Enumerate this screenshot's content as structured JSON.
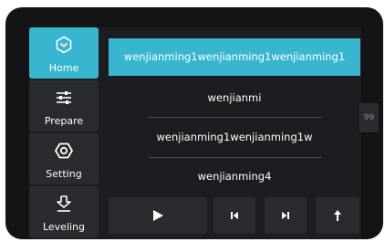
{
  "sidebar": {
    "items": [
      {
        "label": "Home",
        "icon": "home-hexagon-icon"
      },
      {
        "label": "Prepare",
        "icon": "sliders-icon"
      },
      {
        "label": "Setting",
        "icon": "settings-hex-icon"
      },
      {
        "label": "Leveling",
        "icon": "leveling-icon"
      }
    ]
  },
  "files": [
    "wenjianming1wenjianming1wenjianming1",
    "wenjianmi",
    "wenjianming1wenjianming1w",
    "wenjianming4"
  ],
  "scroll_indicator": "99",
  "controls": [
    "play-icon",
    "previous-icon",
    "next-icon",
    "upload-icon"
  ],
  "colors": {
    "accent": "#39b6cf",
    "panel": "#2a2b2f",
    "background": "#1c1d20"
  }
}
